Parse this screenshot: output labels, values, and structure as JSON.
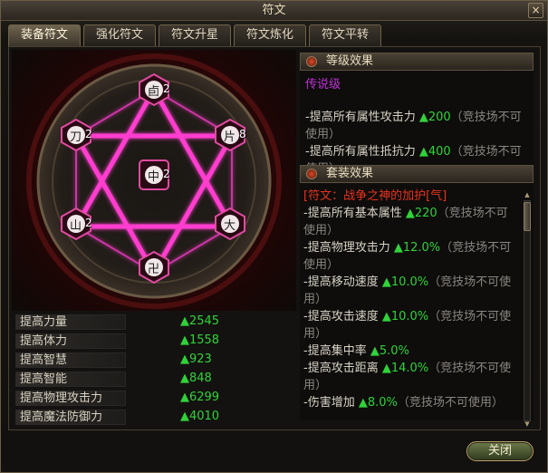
{
  "window": {
    "title": "符文",
    "close_glyph": "×"
  },
  "tabs": [
    "装备符文",
    "强化符文",
    "符文升星",
    "符文炼化",
    "符文平转"
  ],
  "active_tab": 0,
  "runes": [
    {
      "slot": "top",
      "count": "2",
      "glyph": "卣"
    },
    {
      "slot": "upper-left",
      "count": "2",
      "glyph": "刀"
    },
    {
      "slot": "upper-right",
      "count": "8",
      "glyph": "片"
    },
    {
      "slot": "center",
      "count": "2",
      "glyph": "中"
    },
    {
      "slot": "lower-left",
      "count": "2",
      "glyph": "山"
    },
    {
      "slot": "lower-right",
      "count": "",
      "glyph": "大"
    },
    {
      "slot": "bottom",
      "count": "",
      "glyph": "卍"
    }
  ],
  "stats": [
    {
      "label": "提高力量",
      "value": "▲2545"
    },
    {
      "label": "提高体力",
      "value": "▲1558"
    },
    {
      "label": "提高智慧",
      "value": "▲923"
    },
    {
      "label": "提高智能",
      "value": "▲848"
    },
    {
      "label": "提高物理攻击力",
      "value": "▲6299"
    },
    {
      "label": "提高魔法防御力",
      "value": "▲4010"
    }
  ],
  "grade": {
    "header": "等级效果",
    "tier": "传说级",
    "lines": [
      {
        "text": "-提高所有属性攻击力 ",
        "val": "▲200",
        "note": "（竞技场不可使用）"
      },
      {
        "text": "-提高所有属性抵抗力 ",
        "val": "▲400",
        "note": "（竞技场不可使用）"
      }
    ]
  },
  "set": {
    "header": "套装效果",
    "title": "[符文：战争之神的加护[气]",
    "lines": [
      {
        "text": "-提高所有基本属性 ",
        "val": "▲220",
        "note": "（竞技场不可使用）"
      },
      {
        "text": "-提高物理攻击力 ",
        "val": "▲12.0%",
        "note": "（竞技场不可使用）"
      },
      {
        "text": "-提高移动速度 ",
        "val": "▲10.0%",
        "note": "（竞技场不可使用）"
      },
      {
        "text": "-提高攻击速度 ",
        "val": "▲10.0%",
        "note": "（竞技场不可使用）"
      },
      {
        "text": "-提高集中率 ",
        "val": "▲5.0%",
        "note": ""
      },
      {
        "text": "-提高攻击距离 ",
        "val": "▲14.0%",
        "note": "（竞技场不可使用）"
      },
      {
        "text": "-伤害增加 ",
        "val": "▲8.0%",
        "note": "（竞技场不可使用）"
      }
    ]
  },
  "buttons": {
    "close_label": "关闭"
  },
  "colors": {
    "stat_value": "#31d23a",
    "legendary": "#c030d8",
    "set_title": "#e8321e",
    "hexagram": "#ff3ccf"
  }
}
